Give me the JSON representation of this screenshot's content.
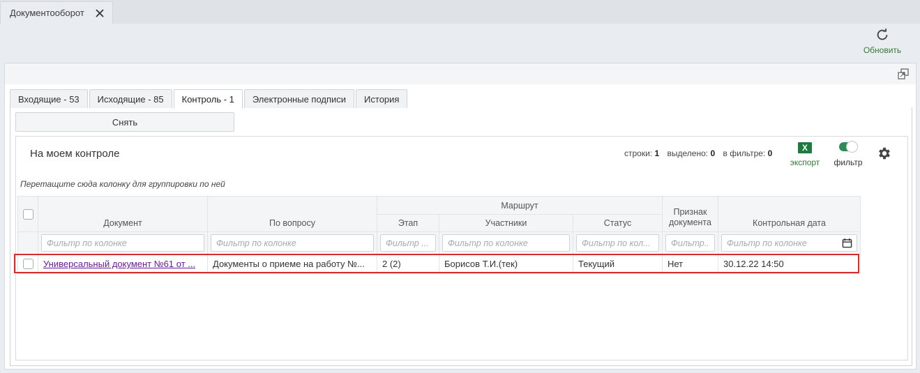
{
  "app_tab": {
    "title": "Документооборот"
  },
  "toolbar": {
    "refresh_label": "Обновить"
  },
  "subtabs": [
    {
      "label": "Входящие - 53",
      "active": false
    },
    {
      "label": "Исходящие - 85",
      "active": false
    },
    {
      "label": "Контроль - 1",
      "active": true
    },
    {
      "label": "Электронные подписи",
      "active": false
    },
    {
      "label": "История",
      "active": false
    }
  ],
  "actions": {
    "remove_label": "Снять"
  },
  "grid": {
    "title": "На моем контроле",
    "stats": {
      "rows_label": "строки:",
      "rows_value": "1",
      "selected_label": "выделено:",
      "selected_value": "0",
      "filtered_label": "в фильтре:",
      "filtered_value": "0"
    },
    "export_label": "экспорт",
    "filter_label": "фильтр",
    "filter_enabled": true,
    "group_hint": "Перетащите сюда колонку для группировки по ней",
    "columns": {
      "document": "Документ",
      "question": "По вопросу",
      "route": "Маршрут",
      "stage": "Этап",
      "participants": "Участники",
      "status": "Статус",
      "sign": "Признак документа",
      "control_date": "Контрольная дата"
    },
    "filter_placeholders": {
      "document": "Фильтр по колонке",
      "question": "Фильтр по колонке",
      "stage": "Фильтр ...",
      "participants": "Фильтр по колонке",
      "status": "Фильтр по кол...",
      "sign": "Фильтр...",
      "control_date": "Фильтр по колонке"
    },
    "rows": [
      {
        "document": "Универсальный документ №61 от ...",
        "question": "Документы о приеме на работу №...",
        "stage": "2 (2)",
        "participants": "Борисов Т.И.(тек)",
        "status": "Текущий",
        "sign": "Нет",
        "control_date": "30.12.22 14:50"
      }
    ]
  },
  "colors": {
    "accent_green": "#2e7d32",
    "link_purple": "#6a1b9a",
    "highlight_red": "#d32f2f"
  }
}
